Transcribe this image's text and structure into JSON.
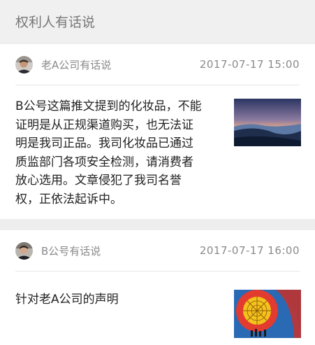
{
  "header": {
    "title": "权利人有话说"
  },
  "posts": [
    {
      "author": "老A公司有话说",
      "time": "2017-07-17  15:00",
      "text": "B公号这篇推文提到的化妆品，不能证明是从正规渠道购买，也无法证明是我司正品。我司化妆品已通过质监部门各项安全检测，请消费者放心选用。文章侵犯了我司名誉权，正依法起诉中。",
      "thumbnail": "landscape-sunset-photo"
    },
    {
      "author": "B公号有话说",
      "time": "2017-07-17  16:00",
      "text": "针对老A公司的声明",
      "thumbnail": "hot-air-balloon-photo"
    }
  ]
}
